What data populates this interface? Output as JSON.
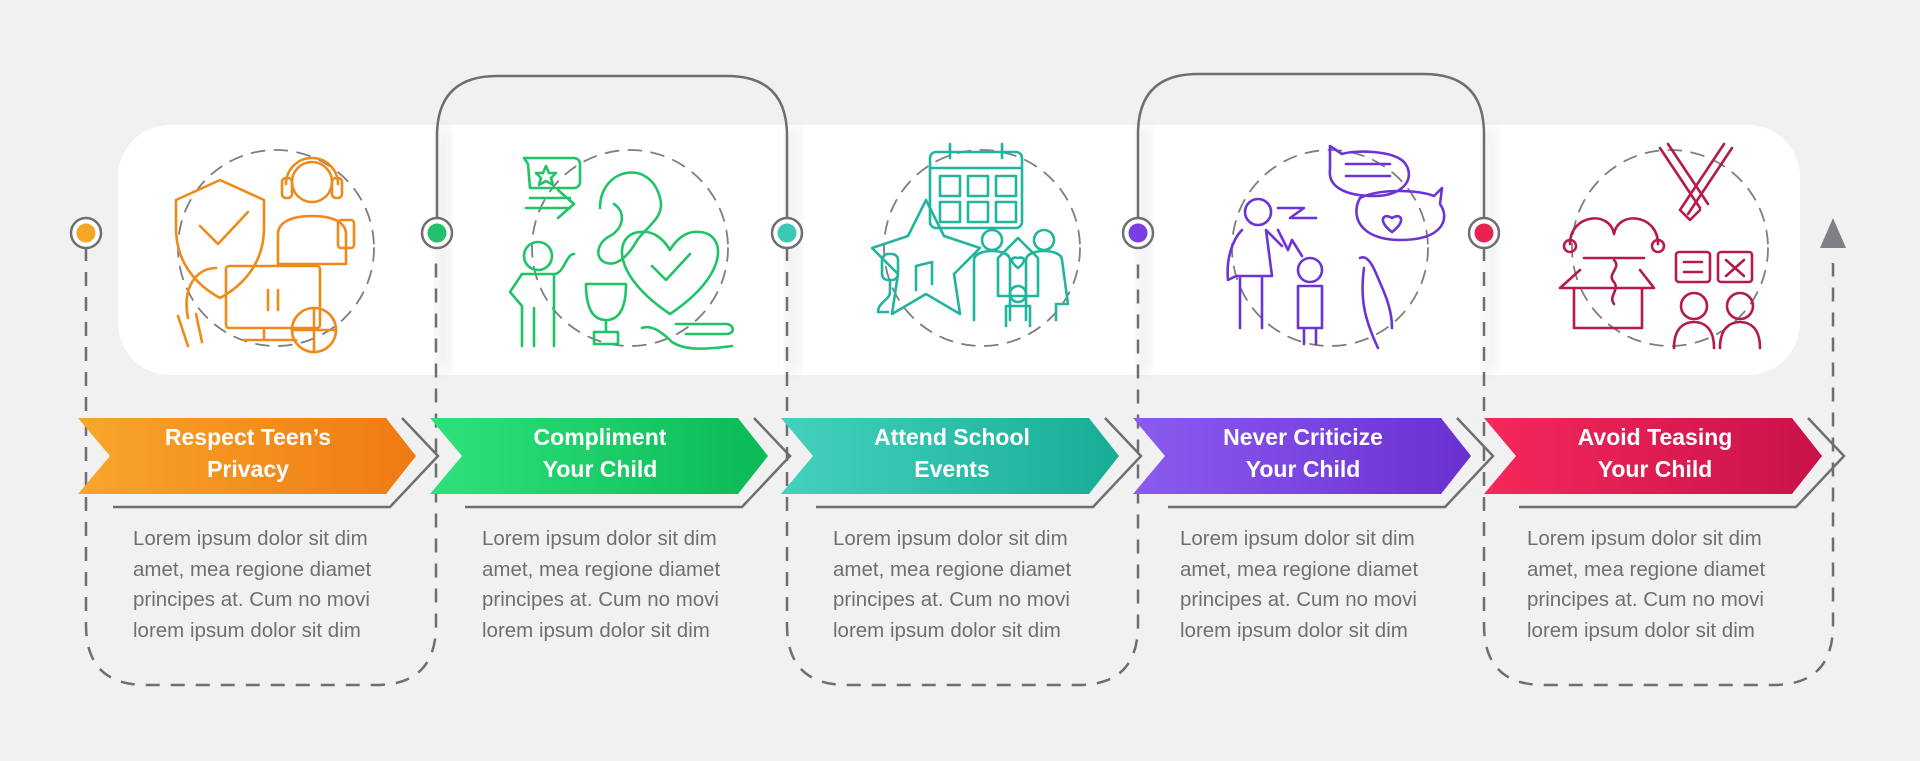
{
  "diagram": {
    "type": "process-infographic",
    "steps": [
      {
        "index": 1,
        "title_line1": "Respect Teen’s",
        "title_line2": "Privacy",
        "icon": "privacy-shield-teen-icon",
        "color_start": "#f8a62b",
        "color_end": "#ef7a12",
        "dot_color": "#f5a623",
        "desc": [
          "Lorem ipsum dolor sit dim",
          "amet, mea regione diamet",
          "principes at. Cum no movi",
          "lorem ipsum dolor sit dim"
        ]
      },
      {
        "index": 2,
        "title_line1": "Compliment",
        "title_line2": "Your Child",
        "icon": "compliment-trophy-ear-icon",
        "color_start": "#2ee27a",
        "color_end": "#0bb957",
        "dot_color": "#22c06a",
        "desc": [
          "Lorem ipsum dolor sit dim",
          "amet, mea regione diamet",
          "principes at. Cum no movi",
          "lorem ipsum dolor sit dim"
        ]
      },
      {
        "index": 3,
        "title_line1": "Attend School",
        "title_line2": "Events",
        "icon": "school-events-calendar-family-icon",
        "color_start": "#44d1bd",
        "color_end": "#17ad96",
        "dot_color": "#3cc8b7",
        "desc": [
          "Lorem ipsum dolor sit dim",
          "amet, mea regione diamet",
          "principes at. Cum no movi",
          "lorem ipsum dolor sit dim"
        ]
      },
      {
        "index": 4,
        "title_line1": "Never Criticize",
        "title_line2": "Your Child",
        "icon": "criticize-parent-child-icon",
        "color_start": "#8b5cf0",
        "color_end": "#6a2fd1",
        "dot_color": "#7a3fe0",
        "desc": [
          "Lorem ipsum dolor sit dim",
          "amet, mea regione diamet",
          "principes at. Cum no movi",
          "lorem ipsum dolor sit dim"
        ]
      },
      {
        "index": 5,
        "title_line1": "Avoid Teasing",
        "title_line2": "Your Child",
        "icon": "teasing-jester-box-icon",
        "color_start": "#f5285a",
        "color_end": "#c8124a",
        "dot_color": "#e8234f",
        "desc": [
          "Lorem ipsum dolor sit dim",
          "amet, mea regione diamet",
          "principes at. Cum no movi",
          "lorem ipsum dolor sit dim"
        ]
      }
    ],
    "connector_color": "#6f6e73",
    "card_color": "#ffffff",
    "background": "#f1f1f1",
    "icon_colors": [
      "#ef8a1a",
      "#1fc466",
      "#22b49f",
      "#6c34d6",
      "#b51a4a"
    ]
  }
}
